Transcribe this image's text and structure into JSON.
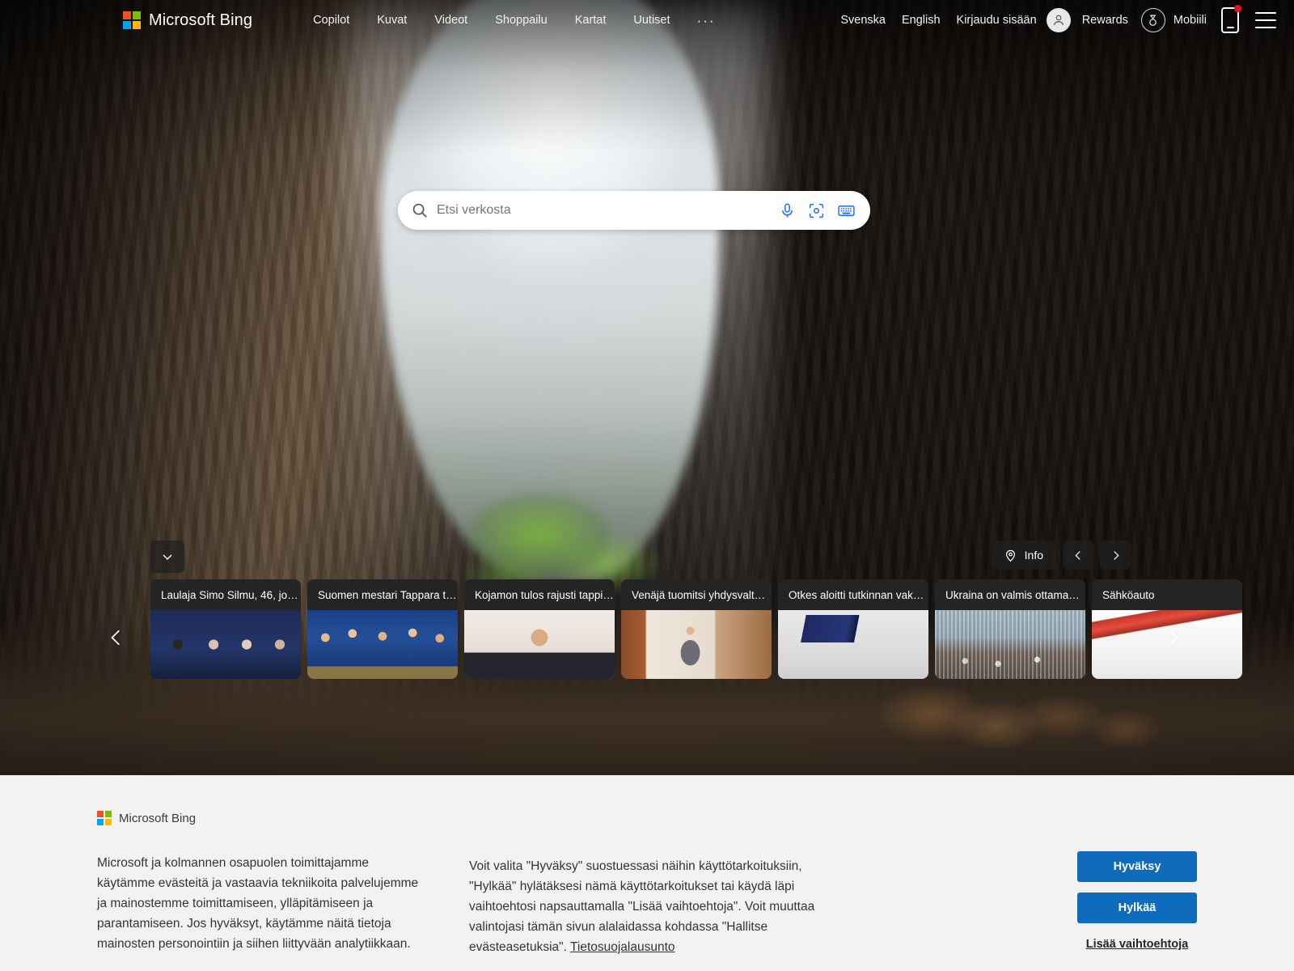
{
  "header": {
    "brand": "Microsoft Bing",
    "brand_icon": "microsoft-logo-icon",
    "nav": [
      {
        "label": "Copilot"
      },
      {
        "label": "Kuvat"
      },
      {
        "label": "Videot"
      },
      {
        "label": "Shoppailu"
      },
      {
        "label": "Kartat"
      },
      {
        "label": "Uutiset"
      }
    ],
    "more_label": "···",
    "right": {
      "lang_sv": "Svenska",
      "lang_en": "English",
      "signin": "Kirjaudu sisään",
      "account_icon": "person-avatar-icon",
      "rewards": "Rewards",
      "rewards_icon": "rewards-medal-icon",
      "mobile": "Mobiili",
      "mobile_icon": "mobile-phone-icon",
      "menu_icon": "hamburger-menu-icon"
    }
  },
  "search": {
    "placeholder": "Etsi verkosta",
    "value": "",
    "search_icon": "search-magnifier-icon",
    "actions": [
      {
        "icon": "microphone-icon",
        "name": "voice-search-button"
      },
      {
        "icon": "visual-search-lens-icon",
        "name": "visual-search-button"
      },
      {
        "icon": "keyboard-icon",
        "name": "virtual-keyboard-button"
      }
    ]
  },
  "strip": {
    "collapse_icon": "chevron-down-icon",
    "info_label": "Info",
    "info_icon": "location-pin-icon",
    "prev_icon": "chevron-left-icon",
    "next_icon": "chevron-right-icon",
    "scroll_left_icon": "chevron-left-icon",
    "scroll_right_icon": "chevron-right-icon",
    "cards": [
      {
        "title": "Laulaja Simo Silmu, 46, jo…",
        "thumb": "th-band"
      },
      {
        "title": "Suomen mestari Tappara t…",
        "thumb": "th-hockey"
      },
      {
        "title": "Kojamon tulos rajusti tappi…",
        "thumb": "th-man"
      },
      {
        "title": "Venäjä tuomitsi yhdysvalt…",
        "thumb": "th-room"
      },
      {
        "title": "Otkes aloitti tutkinnan vak…",
        "thumb": "th-plane"
      },
      {
        "title": "Ukraina on valmis ottama…",
        "thumb": "th-street"
      },
      {
        "title": "Sähköauto",
        "thumb": "th-car"
      }
    ]
  },
  "cookie": {
    "brand": "Microsoft Bing",
    "brand_icon": "microsoft-logo-icon",
    "text_left": "Microsoft ja kolmannen osapuolen toimittajamme käytämme evästeitä ja vastaavia tekniikoita palvelujemme ja mainostemme toimittamiseen, ylläpitämiseen ja parantamiseen. Jos hyväksyt, käytämme näitä tietoja mainosten personointiin ja siihen liittyvään analytiikkaan.",
    "text_right": "Voit valita \"Hyväksy\" suostuessasi näihin käyttötarkoituksiin, \"Hylkää\" hylätäksesi nämä käyttötarkoitukset tai käydä läpi vaihtoehtosi napsauttamalla \"Lisää vaihtoehtoja\". Voit muuttaa valintojasi tämän sivun alalaidassa kohdassa \"Hallitse evästeasetuksia\". ",
    "privacy_link": "Tietosuojalausunto",
    "accept": "Hyväksy",
    "reject": "Hylkää",
    "more_options": "Lisää vaihtoehtoja"
  },
  "colors": {
    "accent_blue": "#0f6cbd",
    "icon_blue": "#1b6ef3",
    "banner_bg": "#f2f2f2",
    "card_bg": "#242424",
    "notification_dot": "#e81123"
  }
}
